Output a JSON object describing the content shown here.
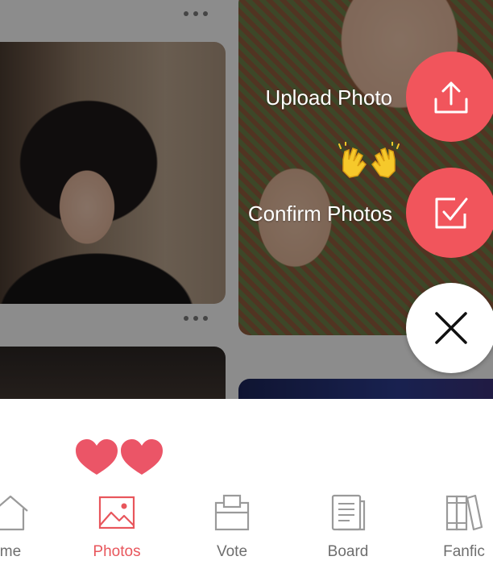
{
  "fab_menu": {
    "upload": {
      "label": "Upload Photo",
      "icon": "upload-icon"
    },
    "confirm": {
      "label": "Confirm Photos",
      "icon": "checkbox-icon"
    },
    "close": {
      "icon": "close-icon"
    },
    "emoji": "raising-hands-emoji"
  },
  "decor": {
    "hearts_icon": "two-hearts-icon"
  },
  "nav": {
    "items": [
      {
        "label": "me",
        "icon": "home-icon"
      },
      {
        "label": "Photos",
        "icon": "photo-icon",
        "active": true
      },
      {
        "label": "Vote",
        "icon": "ballot-box-icon"
      },
      {
        "label": "Board",
        "icon": "document-icon"
      },
      {
        "label": "Fanfic",
        "icon": "books-icon"
      }
    ]
  },
  "colors": {
    "accent": "#f1555c",
    "active_label": "#e8565c",
    "inactive_label": "#6e6e6e",
    "icon_gray": "#9a9a9a"
  }
}
